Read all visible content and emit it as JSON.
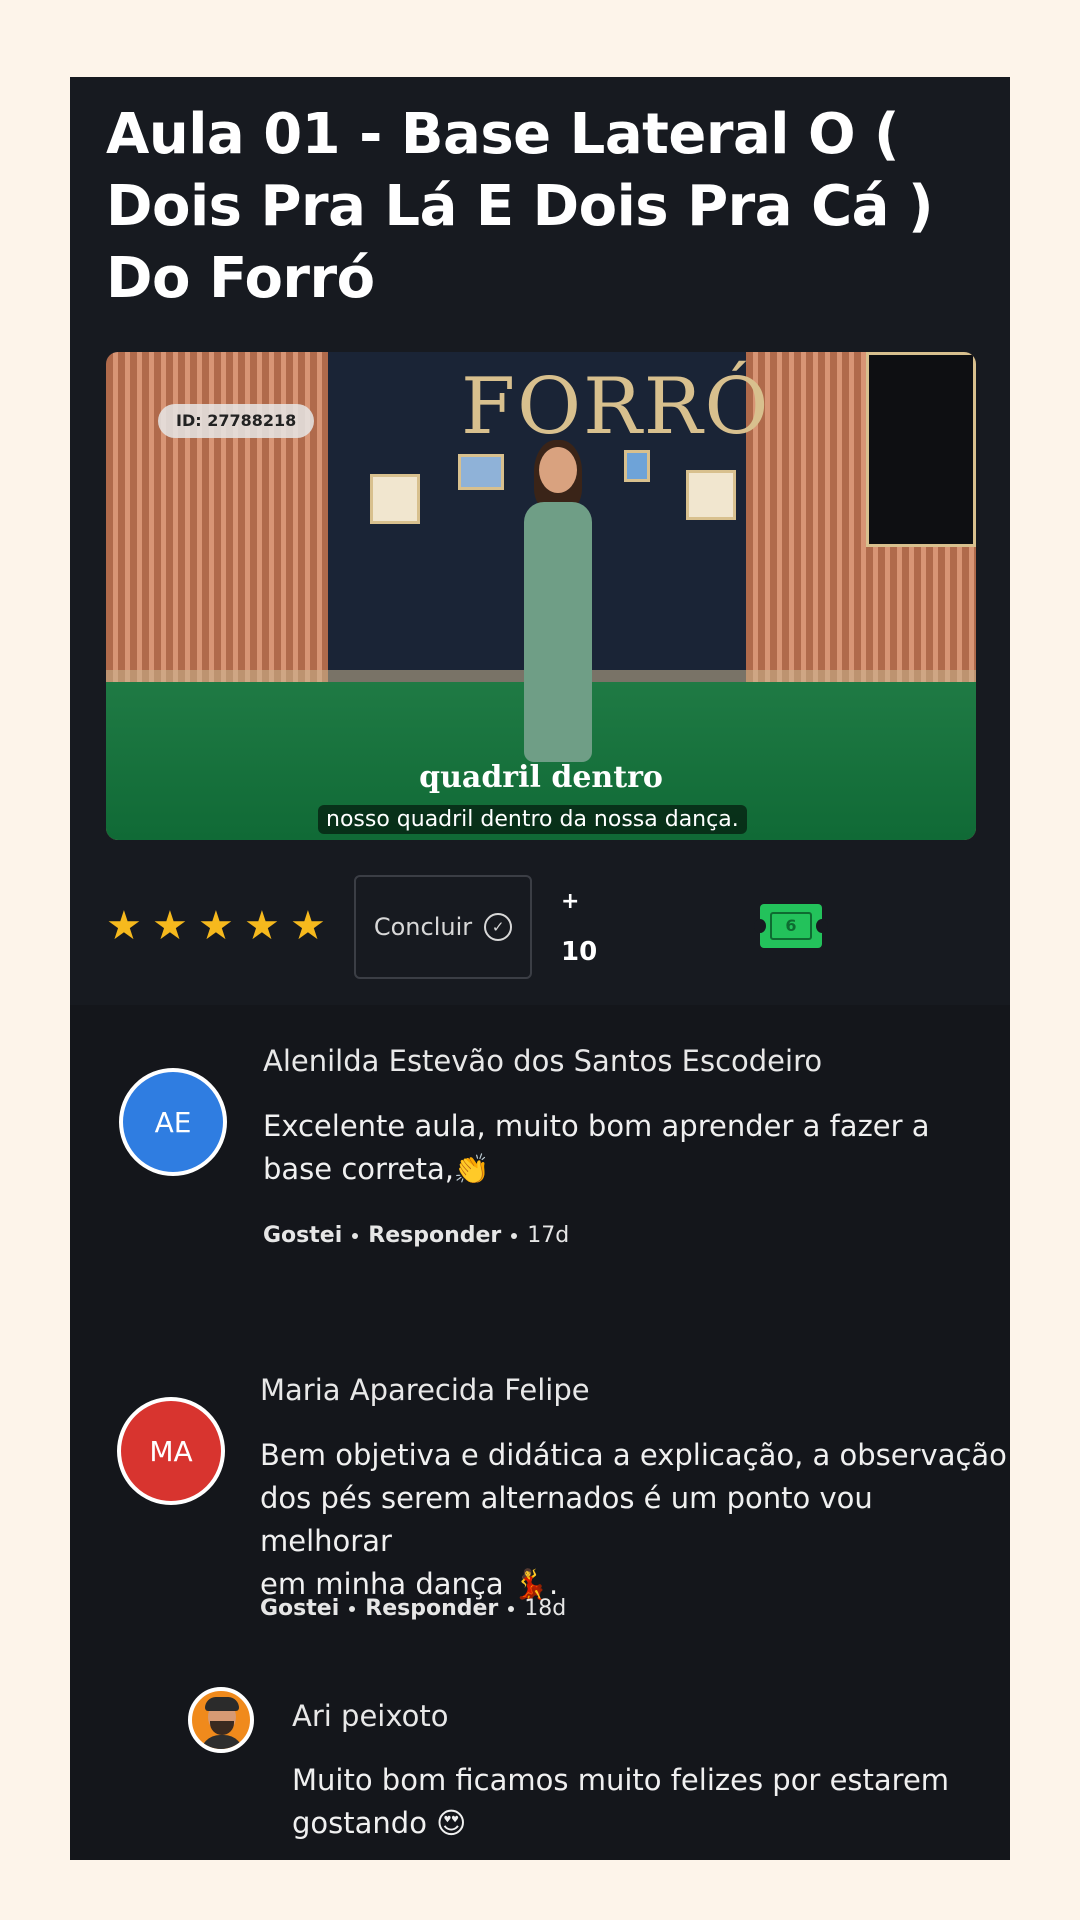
{
  "lesson": {
    "title": "Aula 01 - Base Lateral O ( Dois Pra Lá E Dois Pra Cá ) Do Forró"
  },
  "video": {
    "id_badge": "ID: 27788218",
    "sign_text": "FORRÓ",
    "caption_big": "quadril dentro",
    "caption_small": "nosso quadril dentro da nossa dança."
  },
  "actions": {
    "rating": 5,
    "stars": [
      "★",
      "★",
      "★",
      "★",
      "★"
    ],
    "conclude_label": "Concluir",
    "points_prefix": "+",
    "points_value": "10",
    "ticket_symbol": "6"
  },
  "comments": [
    {
      "initials": "AE",
      "avatar_color": "#2f7de1",
      "name": "Alenilda Estevão dos Santos Escodeiro",
      "text_line1": "Excelente aula, muito bom aprender a fazer a",
      "text_line2": "base correta,👏",
      "like_label": "Gostei",
      "reply_label": "Responder",
      "age": "17d"
    },
    {
      "initials": "MA",
      "avatar_color": "#d8342f",
      "name": "Maria Aparecida Felipe",
      "text_line1": "Bem objetiva e didática a explicação, a observação",
      "text_line2": "dos pés serem alternados é um ponto vou melhorar",
      "text_line3": "em minha dança 💃.",
      "like_label": "Gostei",
      "reply_label": "Responder",
      "age": "18d"
    },
    {
      "name": "Ari peixoto",
      "text_line1": "Muito bom ficamos muito felizes por estarem",
      "text_line2": "gostando 😍"
    }
  ]
}
